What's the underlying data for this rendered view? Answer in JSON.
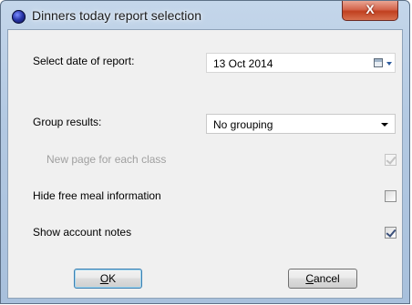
{
  "window": {
    "title": "Dinners today report selection",
    "close_glyph": "X"
  },
  "form": {
    "date_label": "Select date of report:",
    "date_value": "13 Oct  2014",
    "group_label": "Group results:",
    "group_value": "No grouping",
    "new_page_label": "New page for each class",
    "new_page_checked": true,
    "new_page_enabled": false,
    "hide_free_label": "Hide free meal information",
    "hide_free_checked": false,
    "show_notes_label": "Show account notes",
    "show_notes_checked": true
  },
  "buttons": {
    "ok_label_mnemonic": "O",
    "ok_label_rest": "K",
    "cancel_label_mnemonic": "C",
    "cancel_label_rest": "ancel"
  },
  "icons": {
    "app": "app-orb-icon",
    "close": "close-icon",
    "calendar": "calendar-icon",
    "dropdown": "chevron-down-icon",
    "check": "check-icon"
  }
}
